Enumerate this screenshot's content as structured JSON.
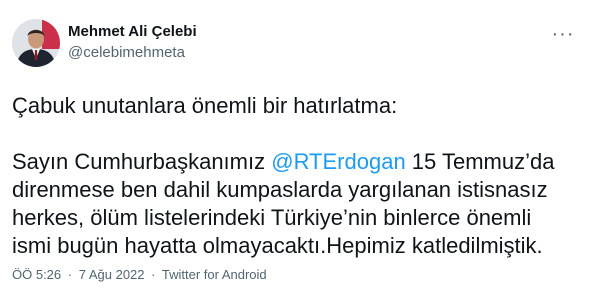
{
  "author": {
    "display_name": "Mehmet Ali Çelebi",
    "handle": "@celebimehmeta"
  },
  "more_icon": "more-horizontal-icon",
  "body": {
    "line1": "Çabuk unutanlara önemli bir hatırlatma:",
    "line2_before": "Sayın Cumhurbaşkanımız ",
    "mention": "@RTErdogan",
    "line2_after": " 15 Temmuz’da",
    "line3": "direnmese ben dahil kumpaslarda yargılanan istisnasız",
    "line4": "herkes, ölüm listelerindeki Türkiye’nin binlerce önemli",
    "line5": "ismi bugün hayatta olmayacaktı.Hepimiz katledilmiştik."
  },
  "meta": {
    "time": "ÖÖ 5:26",
    "separator": "·",
    "date": "7 Ağu 2022",
    "source": "Twitter for Android"
  },
  "colors": {
    "text": "#0f1419",
    "secondary": "#536471",
    "link": "#1d9bf0"
  }
}
